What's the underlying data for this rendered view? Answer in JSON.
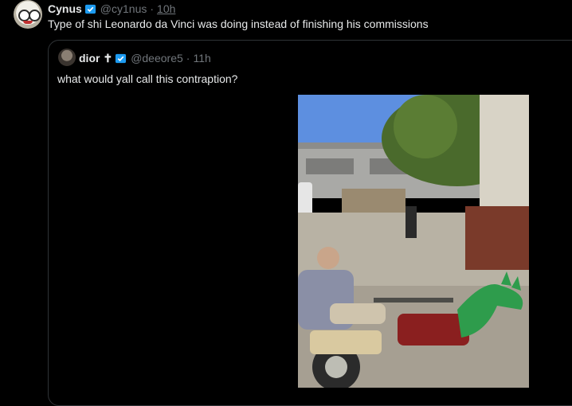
{
  "tweet": {
    "author_name": "Cynus",
    "handle": "@cy1nus",
    "separator": "·",
    "time": "10h",
    "text": "Type of shi Leonardo da Vinci was doing instead of finishing his commissions"
  },
  "quoted": {
    "author_name": "dior",
    "handle": "@deeore5",
    "separator": "·",
    "time": "11h",
    "text": "what would yall call this contraption?"
  },
  "colors": {
    "background": "#000000",
    "text": "#e7e9ea",
    "muted": "#71767b",
    "verified": "#1d9bf0",
    "border": "#2f3336"
  },
  "icons": [
    "verified-badge-icon",
    "cross-icon"
  ]
}
